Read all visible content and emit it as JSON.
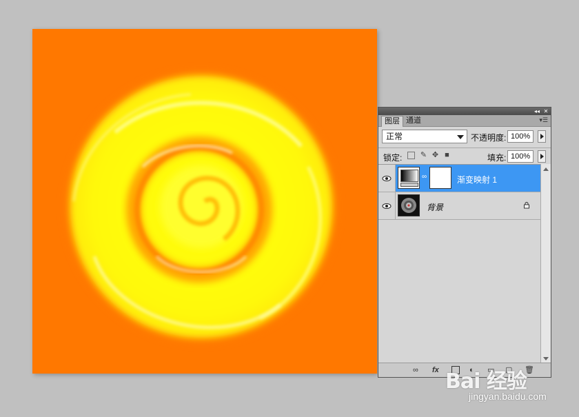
{
  "panel": {
    "tabs": [
      {
        "label": "图层"
      },
      {
        "label": "通道"
      }
    ],
    "blend_mode": "正常",
    "opacity_label": "不透明度:",
    "opacity_value": "100%",
    "lock_label": "锁定:",
    "fill_label": "填充:",
    "fill_value": "100%",
    "layers": [
      {
        "name": "渐变映射 1",
        "selected": true
      },
      {
        "name": "背景",
        "selected": false,
        "locked": true
      }
    ],
    "bottom_icons": [
      "link-icon",
      "fx-icon",
      "mask-icon",
      "adjustment-icon",
      "folder-icon",
      "new-layer-icon",
      "trash-icon"
    ],
    "bottom_fx": "fx"
  },
  "watermark": {
    "logo": "Bai 经验",
    "url": "jingyan.baidu.com"
  },
  "colors": {
    "canvas_bg": "#ff7800",
    "swirl_yellow": "#ffff00",
    "selected_layer": "#3d97f3"
  }
}
